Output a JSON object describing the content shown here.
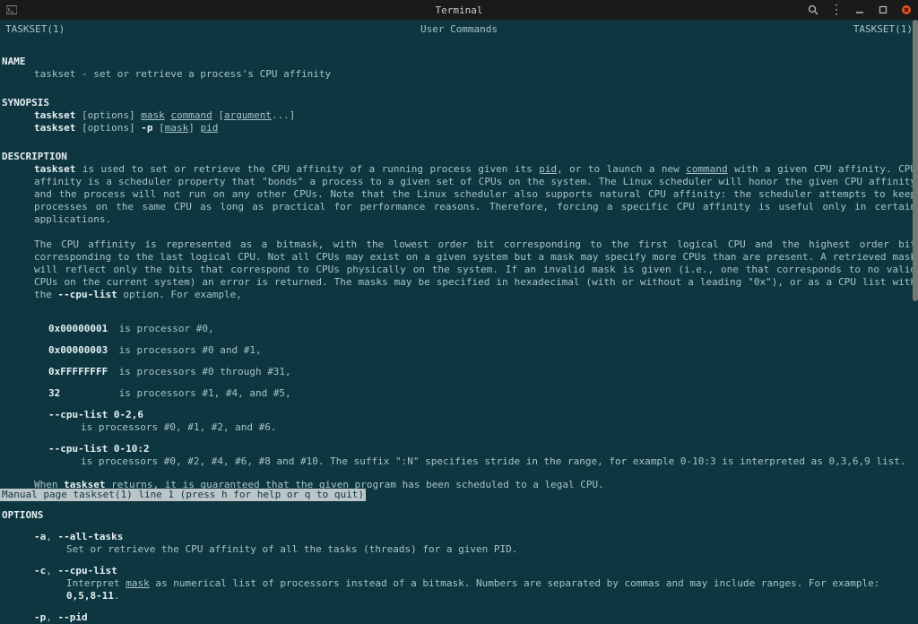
{
  "window": {
    "title": "Terminal"
  },
  "header": {
    "left": "TASKSET(1)",
    "center": "User Commands",
    "right": "TASKSET(1)"
  },
  "sections": {
    "name_head": "NAME",
    "name_body": "taskset - set or retrieve a process's CPU affinity",
    "synopsis_head": "SYNOPSIS",
    "syn1_cmd": "taskset",
    "syn1_opts": " [options] ",
    "syn1_mask": "mask",
    "syn1_sp": " ",
    "syn1_command": "command",
    "syn1_sp2": " [",
    "syn1_arg": "argument",
    "syn1_end": "...]",
    "syn2_cmd": "taskset",
    "syn2_opts": " [options] ",
    "syn2_p": "-p",
    "syn2_sp": " [",
    "syn2_mask": "mask",
    "syn2_sp2": "] ",
    "syn2_pid": "pid",
    "description_head": "DESCRIPTION",
    "desc1_a": "taskset",
    "desc1_b": "  is  used to set or retrieve the CPU affinity of a running process given its ",
    "desc1_c": "pid",
    "desc1_d": ", or to launch a new ",
    "desc1_e": "command",
    "desc1_f": " with a given CPU affinity.  CPU affinity is a scheduler property that \"bonds\" a process to a given set of CPUs on the system.  The Linux scheduler will honor the given CPU affinity and the process will not run on  any  other  CPUs.   Note that  the  Linux  scheduler also supports natural CPU affinity: the scheduler attempts to keep processes on the same CPU as long as practical for performance reasons.  Therefore, forcing a specific CPU affinity is useful only in certain applications.",
    "desc2_a": "The CPU affinity is represented as a bitmask, with the lowest order bit corresponding to the first logical CPU and the highest order bit corresponding to the  last  logical  CPU.  Not all CPUs may exist on a given system but a mask may specify more CPUs than are present.  A retrieved mask will reflect only the bits that correspond to CPUs physically on the system.  If an invalid mask is given (i.e., one that corresponds to no valid CPUs on the current system) an error is returned.  The masks may be specified in hexadecimal (with or without a leading \"0x\"), or as a CPU list with the ",
    "desc2_b": "--cpu-list",
    "desc2_c": " option.  For example,",
    "ex1_k": "0x00000001",
    "ex1_v": "is processor #0,",
    "ex2_k": "0x00000003",
    "ex2_v": "is processors #0 and #1,",
    "ex3_k": "0xFFFFFFFF",
    "ex3_v": "is processors #0 through #31,",
    "ex4_k": "32",
    "ex4_v": "is processors #1, #4, and #5,",
    "ex5_k": "--cpu-list 0-2,6",
    "ex5_v": "is processors #0, #1, #2, and #6.",
    "ex6_k": "--cpu-list 0-10:2",
    "ex6_v": "is processors #0, #2, #4, #6, #8 and #10. The suffix \":N\" specifies stride in the range, for example 0-10:3 is interpreted as 0,3,6,9 list.",
    "desc3_a": "When ",
    "desc3_b": "taskset",
    "desc3_c": " returns, it is guaranteed that the given program has been scheduled to a legal CPU.",
    "options_head": "OPTIONS",
    "opt_a_k": "-a",
    "opt_a_sep": ", ",
    "opt_a_k2": "--all-tasks",
    "opt_a_v": "Set or retrieve the CPU affinity of all the tasks (threads) for a given PID.",
    "opt_c_k": "-c",
    "opt_c_sep": ", ",
    "opt_c_k2": "--cpu-list",
    "opt_c_v1": "Interpret ",
    "opt_c_mask": "mask",
    "opt_c_v2": " as numerical list of processors instead of a bitmask.  Numbers are separated by commas and may include ranges.  For example: ",
    "opt_c_v3": "0,5,8-11",
    "opt_c_v4": ".",
    "opt_p_k": "-p",
    "opt_p_sep": ", ",
    "opt_p_k2": "--pid"
  },
  "status": " Manual page taskset(1) line 1 (press h for help or q to quit)"
}
